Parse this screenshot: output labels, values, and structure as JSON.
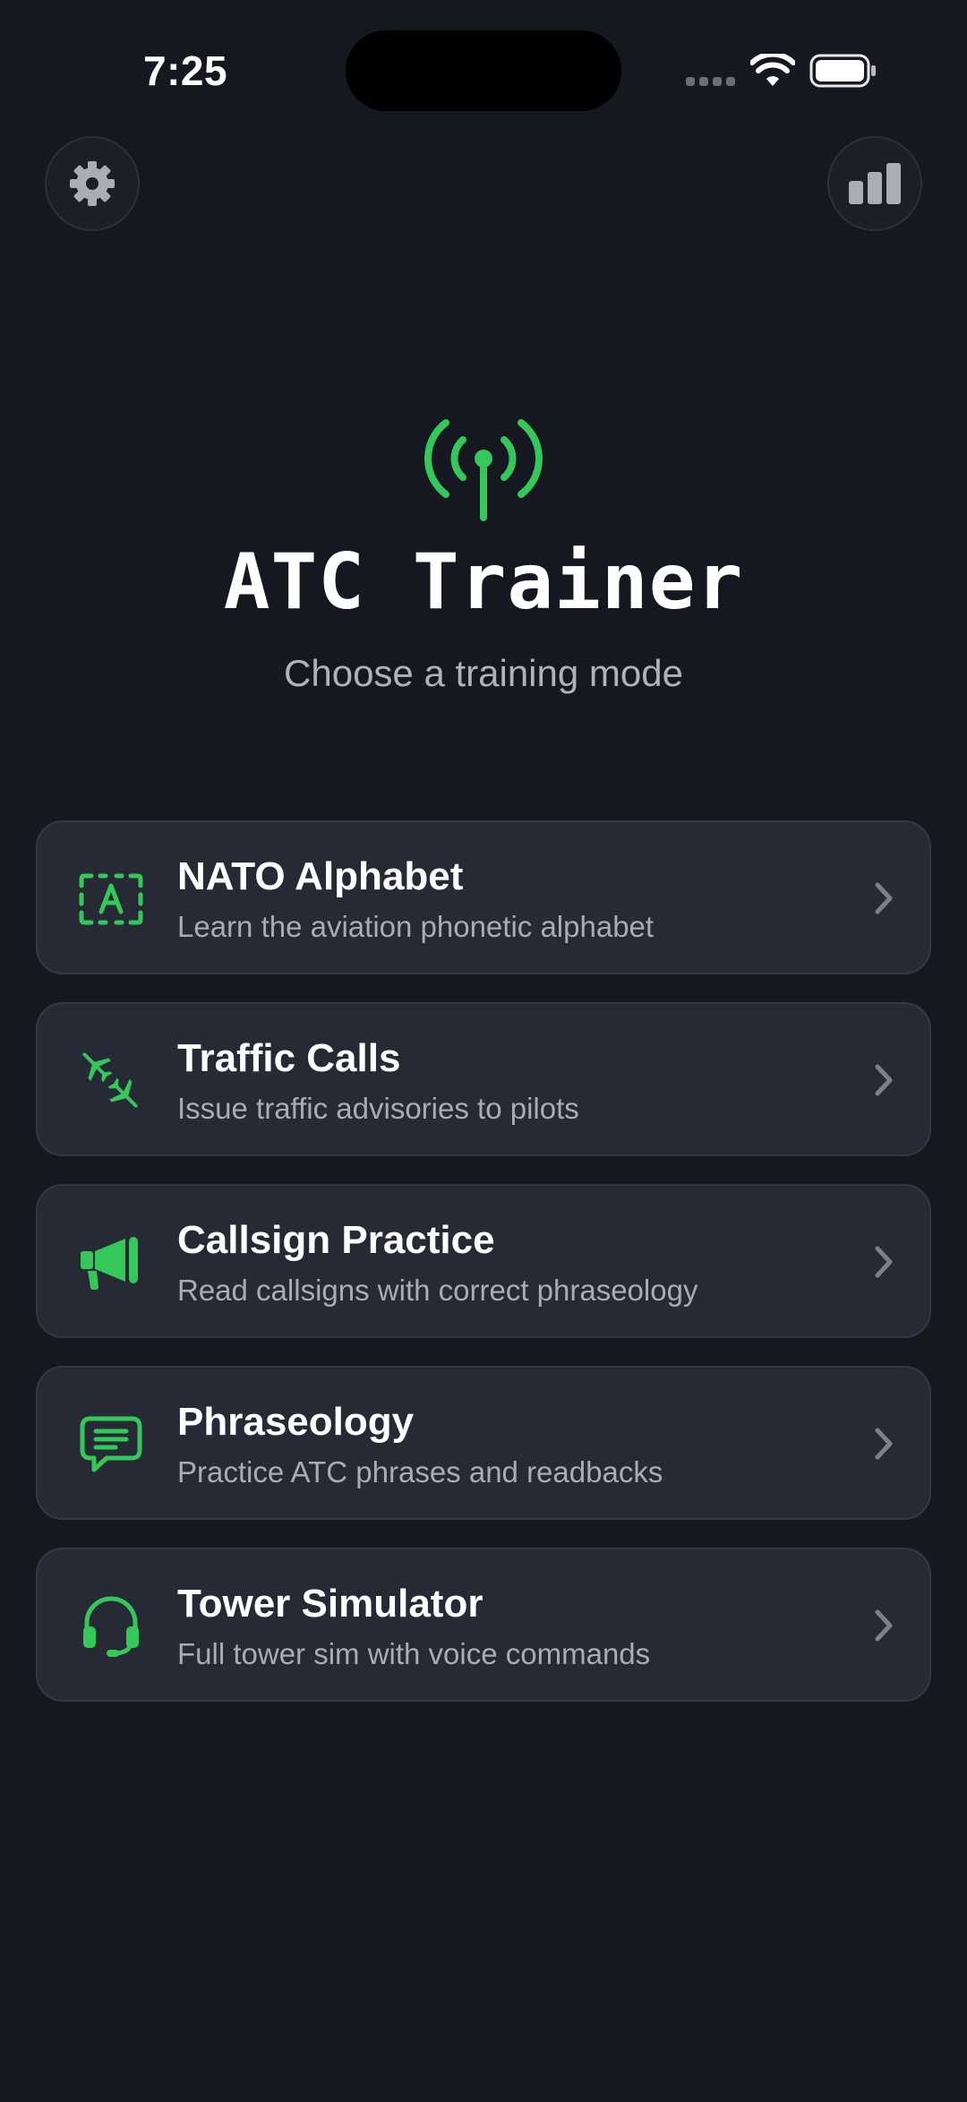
{
  "status_bar": {
    "time": "7:25"
  },
  "header": {
    "settings_icon": "gear-icon",
    "stats_icon": "bar-chart-icon"
  },
  "hero": {
    "icon": "antenna-broadcast-icon",
    "title": "ATC Trainer",
    "subtitle": "Choose a training mode"
  },
  "colors": {
    "background": "#151820",
    "card": "#252a34",
    "accent": "#34c759",
    "secondary_text": "#a8acb4"
  },
  "modes": [
    {
      "title": "NATO Alphabet",
      "description": "Learn the aviation phonetic alphabet",
      "icon": "letter-a-icon"
    },
    {
      "title": "Traffic Calls",
      "description": "Issue traffic advisories to pilots",
      "icon": "airplanes-icon"
    },
    {
      "title": "Callsign Practice",
      "description": "Read callsigns with correct phraseology",
      "icon": "megaphone-icon"
    },
    {
      "title": "Phraseology",
      "description": "Practice ATC phrases and readbacks",
      "icon": "message-icon"
    },
    {
      "title": "Tower Simulator",
      "description": "Full tower sim with voice commands",
      "icon": "headset-icon"
    }
  ]
}
